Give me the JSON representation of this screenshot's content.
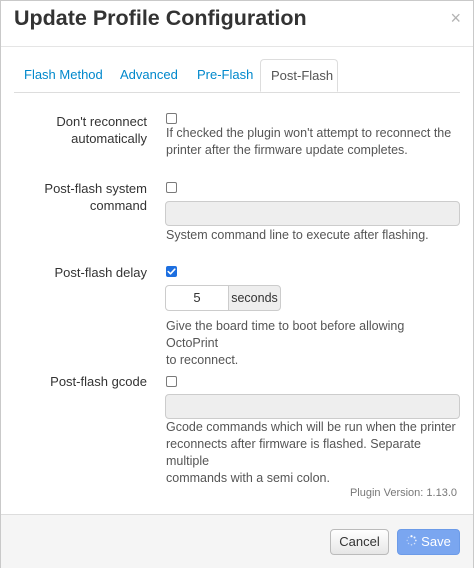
{
  "dialog": {
    "title": "Update Profile Configuration",
    "close_symbol": "×"
  },
  "tabs": [
    {
      "label": "Flash Method",
      "active": false
    },
    {
      "label": "Advanced",
      "active": false
    },
    {
      "label": "Pre-Flash",
      "active": false
    },
    {
      "label": "Post-Flash",
      "active": true
    }
  ],
  "fields": {
    "no_reconnect": {
      "label_line1": "Don't reconnect",
      "label_line2": "automatically",
      "checked": false,
      "help_line1": "If checked the plugin won't attempt to reconnect the",
      "help_line2": "printer after the firmware update completes."
    },
    "post_flash_command": {
      "label_line1": "Post-flash system",
      "label_line2": "command",
      "checked": false,
      "value": "",
      "help": "System command line to execute after flashing."
    },
    "post_flash_delay": {
      "label": "Post-flash delay",
      "checked": true,
      "value": "5",
      "unit": "seconds",
      "help_line1": "Give the board time to boot before allowing OctoPrint",
      "help_line2": "to reconnect."
    },
    "post_flash_gcode": {
      "label": "Post-flash gcode",
      "checked": false,
      "value": "",
      "help_line1": "Gcode commands which will be run when the printer",
      "help_line2": "reconnects after firmware is flashed. Separate multiple",
      "help_line3": "commands with a semi colon."
    }
  },
  "plugin_version": "Plugin Version: 1.13.0",
  "footer": {
    "cancel_label": "Cancel",
    "save_label": "Save"
  },
  "colors": {
    "accent": "#0088cc",
    "checkbox_checked": "#1d6fe0",
    "save_button": "#7aa6f0"
  }
}
